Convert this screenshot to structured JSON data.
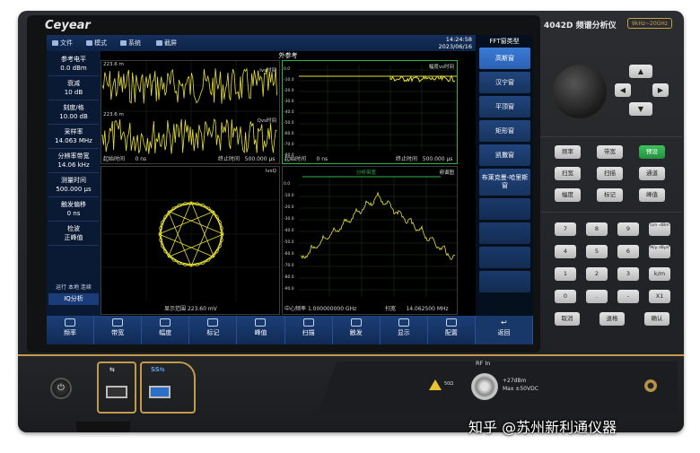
{
  "device": {
    "brand": "Ceyear",
    "model_title": "4042D 频谱分析仪",
    "freq_badge": "9kHz~20GHz"
  },
  "topbar": {
    "menu": [
      "文件",
      "模式",
      "系统",
      "截屏"
    ],
    "time": "14:24:58",
    "date": "2023/06/16"
  },
  "center_title": "外参考",
  "params": [
    {
      "label": "参考电平",
      "value": "0.0 dBm"
    },
    {
      "label": "衰减",
      "value": "10 dB"
    },
    {
      "label": "刻度/格",
      "value": "10.00 dB"
    },
    {
      "label": "采样率",
      "value": "14.063 MHz"
    },
    {
      "label": "分辨率带宽",
      "value": "14.06 kHz"
    },
    {
      "label": "测量时间",
      "value": "500.000 μs"
    },
    {
      "label": "触发偏移",
      "value": "0 ns"
    },
    {
      "label": "检波",
      "value": "正峰值"
    }
  ],
  "status_text": "运行 本地 连续",
  "iq_button": "IQ分析",
  "panes": {
    "i_vs_time": "Ivs时间",
    "q_vs_time": "Qvs时间",
    "mag_vs_time": "幅度vs时间",
    "ivsq": "IvsQ",
    "spectrum": "频谱图",
    "analysis_bw": "分析带宽",
    "start_time_label": "起始时间",
    "start_time_value": "0 ns",
    "stop_time_label": "终止时间",
    "stop_time_value": "500.000 μs",
    "display_range_label": "显示范围",
    "display_range_value": "223.60 mV",
    "center_freq_label": "中心频率",
    "center_freq_value": "1.000000000 GHz",
    "span_label": "扫宽",
    "span_value": "14.062500 MHz",
    "mag_axis": [
      "0.0",
      "-10.0",
      "-20.0",
      "-30.0",
      "-40.0",
      "-50.0",
      "-60.0",
      "-70.0",
      "-80.0"
    ],
    "spec_axis": [
      "0.0",
      "-10.0",
      "-20.0",
      "-30.0",
      "-40.0",
      "-50.0",
      "-60.0",
      "-70.0",
      "-80.0",
      "-90.0"
    ],
    "iq_top_tick": "223.6 m",
    "q_top_tick": "223.6 m"
  },
  "softkeys": {
    "title": "FFT窗类型",
    "items": [
      "高斯窗",
      "汉宁窗",
      "平顶窗",
      "矩形窗",
      "凯撒窗",
      "布莱克曼-哈里斯窗"
    ]
  },
  "bottom_menu": [
    "频率",
    "带宽",
    "幅度",
    "标记",
    "峰值",
    "扫描",
    "触发",
    "显示",
    "配置"
  ],
  "return_label": "返回",
  "hardkeys": {
    "row1": [
      "频率",
      "带宽",
      "预设"
    ],
    "row2": [
      "扫宽",
      "扫描",
      "通道"
    ],
    "row3": [
      "幅度",
      "标记",
      "峰值"
    ],
    "numpad": [
      [
        "7",
        "8",
        "9",
        "G/n -dBm"
      ],
      [
        "4",
        "5",
        "6",
        "M/μ dBμV"
      ],
      [
        "1",
        "2",
        "3",
        "k/m"
      ],
      [
        "0",
        ".",
        "-",
        "X1"
      ]
    ],
    "bottom": [
      "取消",
      "退格",
      "确认"
    ],
    "arrows": [
      "▲",
      "◀",
      "▶",
      "▼"
    ]
  },
  "front": {
    "usb_label": "⇆",
    "usb3_label": "SS⇆",
    "rf_label": "RF In",
    "warn_text": "50Ω",
    "spec_lines": [
      "+27dBm",
      "Max ±50VDC"
    ],
    "power_symbol": "⏻"
  },
  "watermark": "知乎 @苏州新利通仪器",
  "colors": {
    "trace_yellow": "#e6e035",
    "grid_green": "#2bb34a",
    "ui_blue": "#173869",
    "accent_gold": "#c29b4a",
    "preset_green": "#2ea84a"
  }
}
